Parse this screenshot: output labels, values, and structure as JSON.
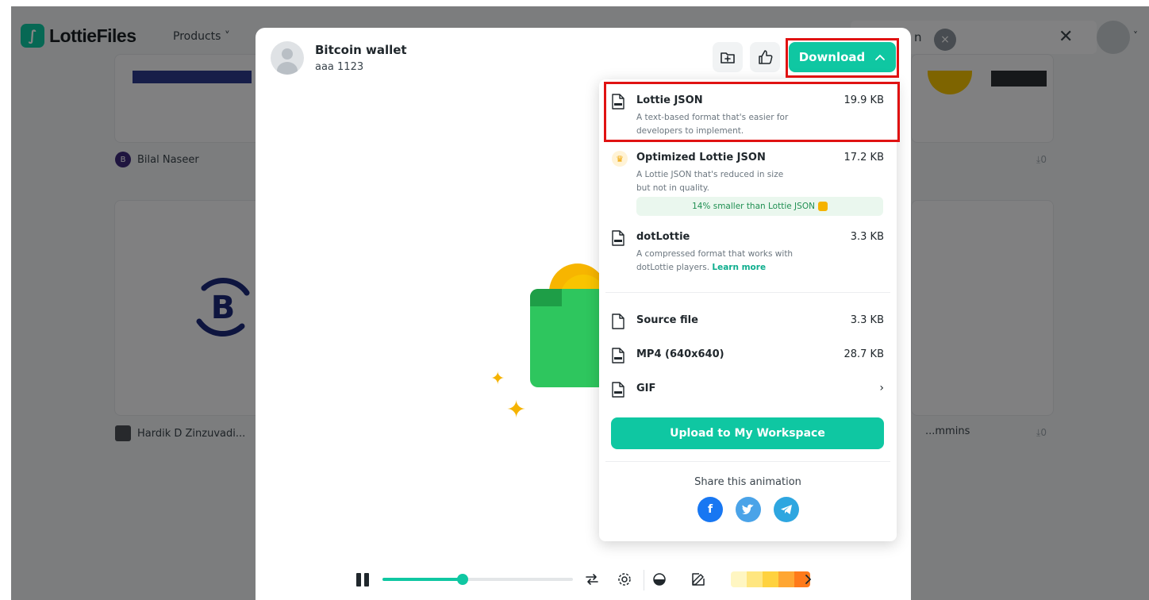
{
  "background": {
    "logo_text": "LottieFiles",
    "nav_products": "Products",
    "search_text": "n",
    "cards": [
      {
        "author": "Bilal Naseer",
        "author_initial": "B"
      },
      {
        "author": "Hardik D Zinzuvadi..."
      },
      {
        "author": "...mmins"
      }
    ],
    "download_counts": [
      "0",
      "0"
    ]
  },
  "modal": {
    "title": "Bitcoin wallet",
    "subtitle": "aaa 1123",
    "download_label": "Download",
    "coin_symbol": "B"
  },
  "dropdown": {
    "options": [
      {
        "name": "Lottie JSON",
        "size": "19.9 KB",
        "description": "A text-based format that's easier for developers to implement."
      },
      {
        "name": "Optimized Lottie JSON",
        "size": "17.2 KB",
        "description": "A Lottie JSON that's reduced in size but not in quality.",
        "badge": "14% smaller than Lottie JSON"
      },
      {
        "name": "dotLottie",
        "size": "3.3 KB",
        "description": "A compressed format that works with dotLottie players.",
        "link": "Learn more"
      },
      {
        "name": "Source file",
        "size": "3.3 KB"
      },
      {
        "name": "MP4 (640x640)",
        "size": "28.7 KB"
      },
      {
        "name": "GIF",
        "size": ""
      }
    ],
    "upload_label": "Upload to My Workspace",
    "share_label": "Share this animation"
  },
  "player": {
    "progress": 0.42,
    "swatch_colors": [
      "#fff6c2",
      "#ffe680",
      "#ffd23f",
      "#ffa632",
      "#ff7a1a"
    ]
  },
  "colors": {
    "accent": "#0fc7a2",
    "highlight": "#e01212",
    "facebook": "#1877f2",
    "twitter": "#4aa3e8",
    "telegram": "#2ea6e0"
  }
}
